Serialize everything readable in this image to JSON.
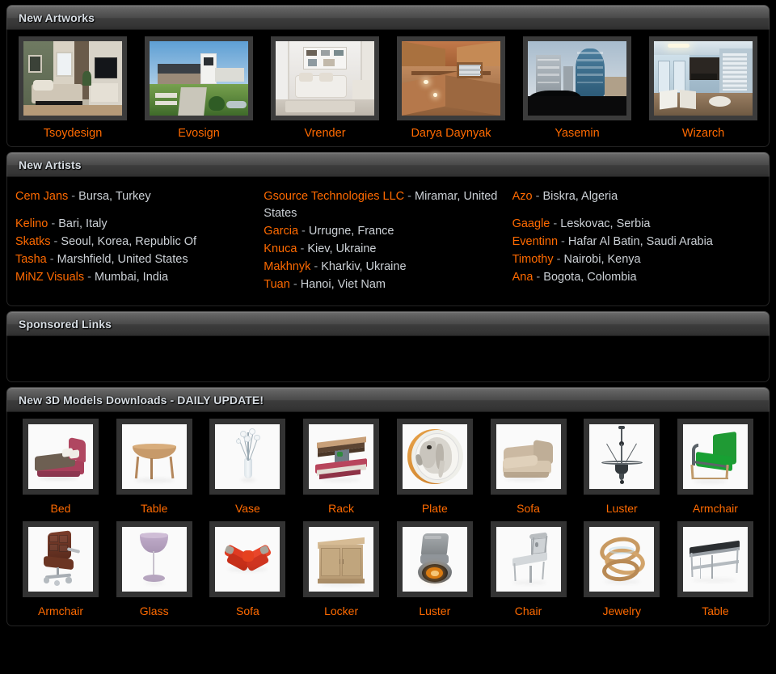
{
  "theme": {
    "background": "#000000",
    "accent": "#ff6a00",
    "panel_header_text": "#d7dde3",
    "body_text": "#ccd1d6",
    "frame": "#3b3b3b"
  },
  "panels": {
    "artworks": {
      "title": "New Artworks"
    },
    "artists": {
      "title": "New Artists"
    },
    "sponsored": {
      "title": "Sponsored Links"
    },
    "models": {
      "title": "New 3D Models Downloads - DAILY UPDATE!"
    }
  },
  "artworks": [
    {
      "label": "Tsoydesign",
      "scene": "bedroom-interior"
    },
    {
      "label": "Evosign",
      "scene": "modern-house-exterior"
    },
    {
      "label": "Vrender",
      "scene": "white-living-room"
    },
    {
      "label": "Darya Daynyak",
      "scene": "wooden-attic"
    },
    {
      "label": "Yasemin",
      "scene": "city-towers"
    },
    {
      "label": "Wizarch",
      "scene": "blue-interior"
    }
  ],
  "artists": {
    "columns": [
      [
        {
          "name": "Cem Jans",
          "sep": " - ",
          "location": "Bursa, Turkey",
          "gap": true
        },
        {
          "name": "Kelino",
          "sep": " - ",
          "location": "Bari, Italy",
          "gap": false
        },
        {
          "name": "Skatks",
          "sep": " - ",
          "location": "Seoul, Korea, Republic Of",
          "gap": false
        },
        {
          "name": "Tasha",
          "sep": " - ",
          "location": "Marshfield, United States",
          "gap": false
        },
        {
          "name": "MiNZ Visuals",
          "sep": " - ",
          "location": "Mumbai, India",
          "gap": false
        }
      ],
      [
        {
          "name": "Gsource Technologies LLC",
          "sep": " - ",
          "location": "Miramar, United States",
          "gap": false
        },
        {
          "name": "Garcia",
          "sep": " - ",
          "location": "Urrugne, France",
          "gap": false
        },
        {
          "name": "Knuca",
          "sep": " - ",
          "location": "Kiev, Ukraine",
          "gap": false
        },
        {
          "name": "Makhnyk",
          "sep": " - ",
          "location": "Kharkiv, Ukraine",
          "gap": false
        },
        {
          "name": "Tuan",
          "sep": " - ",
          "location": "Hanoi, Viet Nam",
          "gap": false
        }
      ],
      [
        {
          "name": "Azo",
          "sep": " - ",
          "location": "Biskra, Algeria",
          "gap": true
        },
        {
          "name": "Gaagle",
          "sep": " - ",
          "location": "Leskovac, Serbia",
          "gap": false
        },
        {
          "name": "Eventinn",
          "sep": " - ",
          "location": "Hafar Al Batin, Saudi Arabia",
          "gap": false
        },
        {
          "name": "Timothy",
          "sep": " - ",
          "location": "Nairobi, Kenya",
          "gap": false
        },
        {
          "name": "Ana",
          "sep": " - ",
          "location": "Bogota, Colombia",
          "gap": false
        }
      ]
    ]
  },
  "models": {
    "rows": [
      [
        {
          "label": "Bed",
          "scene": "bed"
        },
        {
          "label": "Table",
          "scene": "table-round"
        },
        {
          "label": "Vase",
          "scene": "vase"
        },
        {
          "label": "Rack",
          "scene": "rack"
        },
        {
          "label": "Plate",
          "scene": "plate-elephant"
        },
        {
          "label": "Sofa",
          "scene": "sofa-beige"
        },
        {
          "label": "Luster",
          "scene": "luster-chandelier"
        },
        {
          "label": "Armchair",
          "scene": "armchair-green"
        }
      ],
      [
        {
          "label": "Armchair",
          "scene": "armchair-office-brown"
        },
        {
          "label": "Glass",
          "scene": "glass-wine"
        },
        {
          "label": "Sofa",
          "scene": "sofa-red-corner"
        },
        {
          "label": "Locker",
          "scene": "locker-wood"
        },
        {
          "label": "Luster",
          "scene": "luster-spot"
        },
        {
          "label": "Chair",
          "scene": "chair-grey"
        },
        {
          "label": "Jewelry",
          "scene": "jewelry-rings"
        },
        {
          "label": "Table",
          "scene": "table-console"
        }
      ]
    ]
  }
}
